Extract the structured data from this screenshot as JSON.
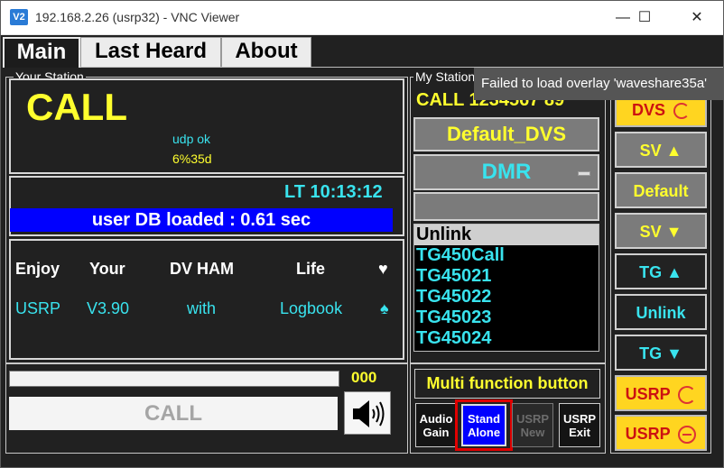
{
  "window": {
    "title": "192.168.2.26 (usrp32) - VNC Viewer",
    "app_icon": "V2",
    "minimize": "—",
    "maximize": "☐",
    "close": "✕"
  },
  "tabs": [
    {
      "label": "Main"
    },
    {
      "label": "Last Heard"
    },
    {
      "label": "About"
    }
  ],
  "your_station": {
    "title": "Your Station",
    "call": "CALL",
    "udp_status": "udp ok",
    "percent": "6%35d",
    "lt_time": "LT 10:13:12",
    "status_bar": "user DB loaded : 0.61 sec"
  },
  "motto": {
    "headers": [
      "Enjoy",
      "Your",
      "DV HAM",
      "Life",
      "♥"
    ],
    "values": [
      "USRP",
      "V3.90",
      "with",
      "Logbook",
      "♠"
    ]
  },
  "call_area": {
    "counter": "000",
    "call_button": "CALL",
    "speaker_icon": "speaker-icon"
  },
  "my_station": {
    "title": "My Station",
    "callsign": "CALL 1234567 89",
    "default_dvs": "Default_DVS",
    "mode": "DMR",
    "input_value": "",
    "talkgroups": [
      "Unlink",
      "TG450Call",
      "TG45021",
      "TG45022",
      "TG45023",
      "TG45024"
    ]
  },
  "multi_function": {
    "label": "Multi function button",
    "buttons": [
      {
        "line1": "Audio",
        "line2": "Gain"
      },
      {
        "line1": "Stand",
        "line2": "Alone"
      },
      {
        "line1": "USRP",
        "line2": "New"
      },
      {
        "line1": "USRP",
        "line2": "Exit"
      }
    ]
  },
  "right_buttons": [
    {
      "label": "DVS"
    },
    {
      "label": "SV ▲"
    },
    {
      "label": "Default"
    },
    {
      "label": "SV ▼"
    },
    {
      "label": "TG ▲"
    },
    {
      "label": "Unlink"
    },
    {
      "label": "TG ▼"
    },
    {
      "label": "USRP"
    },
    {
      "label": "USRP"
    }
  ],
  "tooltip": "Failed to load overlay 'waveshare35a'",
  "colors": {
    "accent_yellow": "#ffff2e",
    "cyan": "#39e3ee",
    "blue_bar": "#0000ff",
    "highlight_red": "#e00000",
    "stand_alone_blue": "#0000ff"
  }
}
